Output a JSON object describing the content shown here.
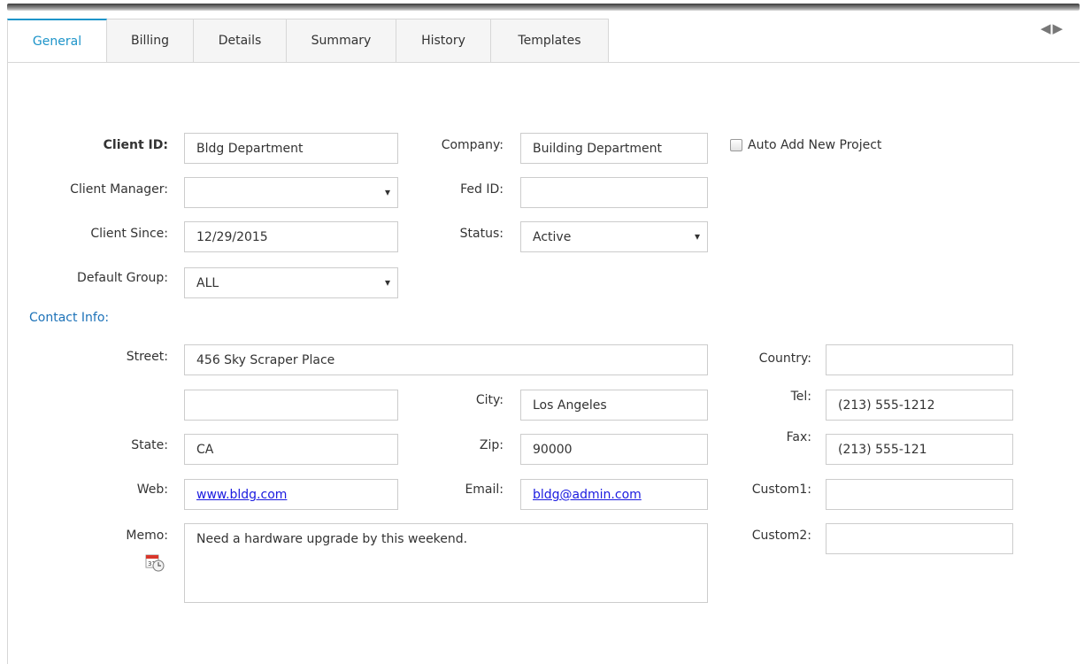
{
  "tabs": [
    "General",
    "Billing",
    "Details",
    "Summary",
    "History",
    "Templates"
  ],
  "nav": {
    "prev_icon": "◀",
    "next_icon": "▶"
  },
  "form": {
    "client_id": {
      "label": "Client ID:",
      "value": "Bldg Department"
    },
    "company": {
      "label": "Company:",
      "value": "Building Department"
    },
    "auto_add": {
      "label": "Auto Add New Project",
      "checked": false
    },
    "client_manager": {
      "label": "Client Manager:",
      "value": ""
    },
    "fed_id": {
      "label": "Fed ID:",
      "value": ""
    },
    "client_since": {
      "label": "Client Since:",
      "value": "12/29/2015"
    },
    "status": {
      "label": "Status:",
      "value": "Active"
    },
    "default_group": {
      "label": "Default Group:",
      "value": "ALL"
    }
  },
  "contact": {
    "section_label": "Contact Info:",
    "street": {
      "label": "Street:",
      "value": "456 Sky Scraper Place",
      "value2": ""
    },
    "country": {
      "label": "Country:",
      "value": ""
    },
    "city": {
      "label": "City:",
      "value": "Los Angeles"
    },
    "tel": {
      "label": "Tel:",
      "value": "(213) 555-1212"
    },
    "state": {
      "label": "State:",
      "value": "CA"
    },
    "zip": {
      "label": "Zip:",
      "value": "90000"
    },
    "fax": {
      "label": "Fax:",
      "value": "(213) 555-121"
    },
    "web": {
      "label": "Web:",
      "value": "www.bldg.com"
    },
    "email": {
      "label": "Email:",
      "value": "bldg@admin.com"
    },
    "custom1": {
      "label": "Custom1:",
      "value": ""
    },
    "custom2": {
      "label": "Custom2:",
      "value": ""
    },
    "memo": {
      "label": "Memo:",
      "value": "Need a hardware upgrade by this weekend."
    }
  },
  "colors": {
    "accent": "#1d94c9",
    "link": "#1a1ae0",
    "section": "#1d72b8"
  }
}
